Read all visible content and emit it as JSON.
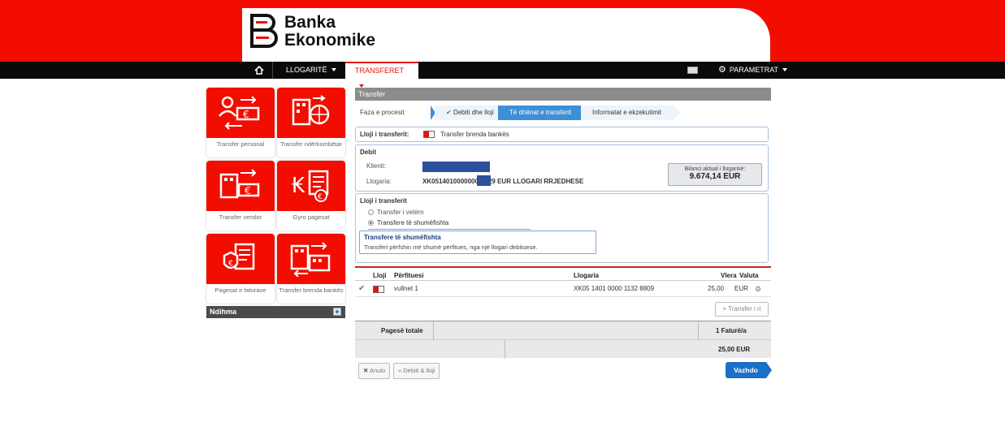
{
  "brand": {
    "line1": "Banka",
    "line2": "Ekonomike",
    "color": "#f20d00"
  },
  "nav": {
    "home_icon": "home-icon",
    "accounts": "LLOGARITË",
    "transfers": "TRANSFERET",
    "mail_icon": "mail-icon",
    "settings_icon": "gear-icon",
    "settings": "PARAMETRAT"
  },
  "tiles": [
    {
      "label": "Transfer personal",
      "icon": "personal-transfer-icon"
    },
    {
      "label": "Transfer ndërkombëtar",
      "icon": "international-transfer-icon"
    },
    {
      "label": "Transfer vendor",
      "icon": "domestic-transfer-icon"
    },
    {
      "label": "Gyro pagesat",
      "icon": "giro-payment-icon"
    },
    {
      "label": "Pagesat e faturave",
      "icon": "bill-payment-icon"
    },
    {
      "label": "Transfer brenda bankës",
      "icon": "internal-transfer-icon"
    }
  ],
  "help": {
    "label": "Ndihma",
    "plus": "+"
  },
  "panel": {
    "title": "Transfer",
    "process_label": "Faza e procesit",
    "steps": [
      "Debiti dhe lloji",
      "Të dhënat e transferit",
      "Informatat e ekzekutimit"
    ],
    "active_step": 2,
    "type_label": "Lloji i transferit:",
    "type_value": "Transfer brenda bankës"
  },
  "debit": {
    "title": "Debit",
    "client_label": "Klienti:",
    "account_label": "Llogaria:",
    "account_prefix": "XK0514010000000",
    "account_suffix": "29 EUR LLOGARI RRJEDHESE",
    "balance_label": "Bilanci aktual i llogarisë:",
    "balance_value": "9.674,14 EUR"
  },
  "transfer_type": {
    "title": "Lloji i transferit",
    "options": [
      "Transfer i vetëm",
      "Transfere të shumëfishta"
    ],
    "selected": 1,
    "info_title": "Transfere të shumëfishta",
    "info_text": "Transferi përfshin më shumë përfitues, nga një llogari debituese."
  },
  "table": {
    "headers": {
      "type": "Lloji",
      "beneficiary": "Përfituesi",
      "account": "Llogaria",
      "amount": "Vlera",
      "currency": "Valuta"
    },
    "rows": [
      {
        "beneficiary": "vullnet 1",
        "account": "XK05 1401 0000 1132 8809",
        "amount": "25,00",
        "currency": "EUR"
      }
    ],
    "new_transfer": "Transfer i ri"
  },
  "totals": {
    "label": "Pagesë totale",
    "count": "1 Faturë/a",
    "amount": "25,00 EUR"
  },
  "buttons": {
    "cancel": "Anulo",
    "back": "Debiti & lloji",
    "continue": "Vazhdo"
  }
}
